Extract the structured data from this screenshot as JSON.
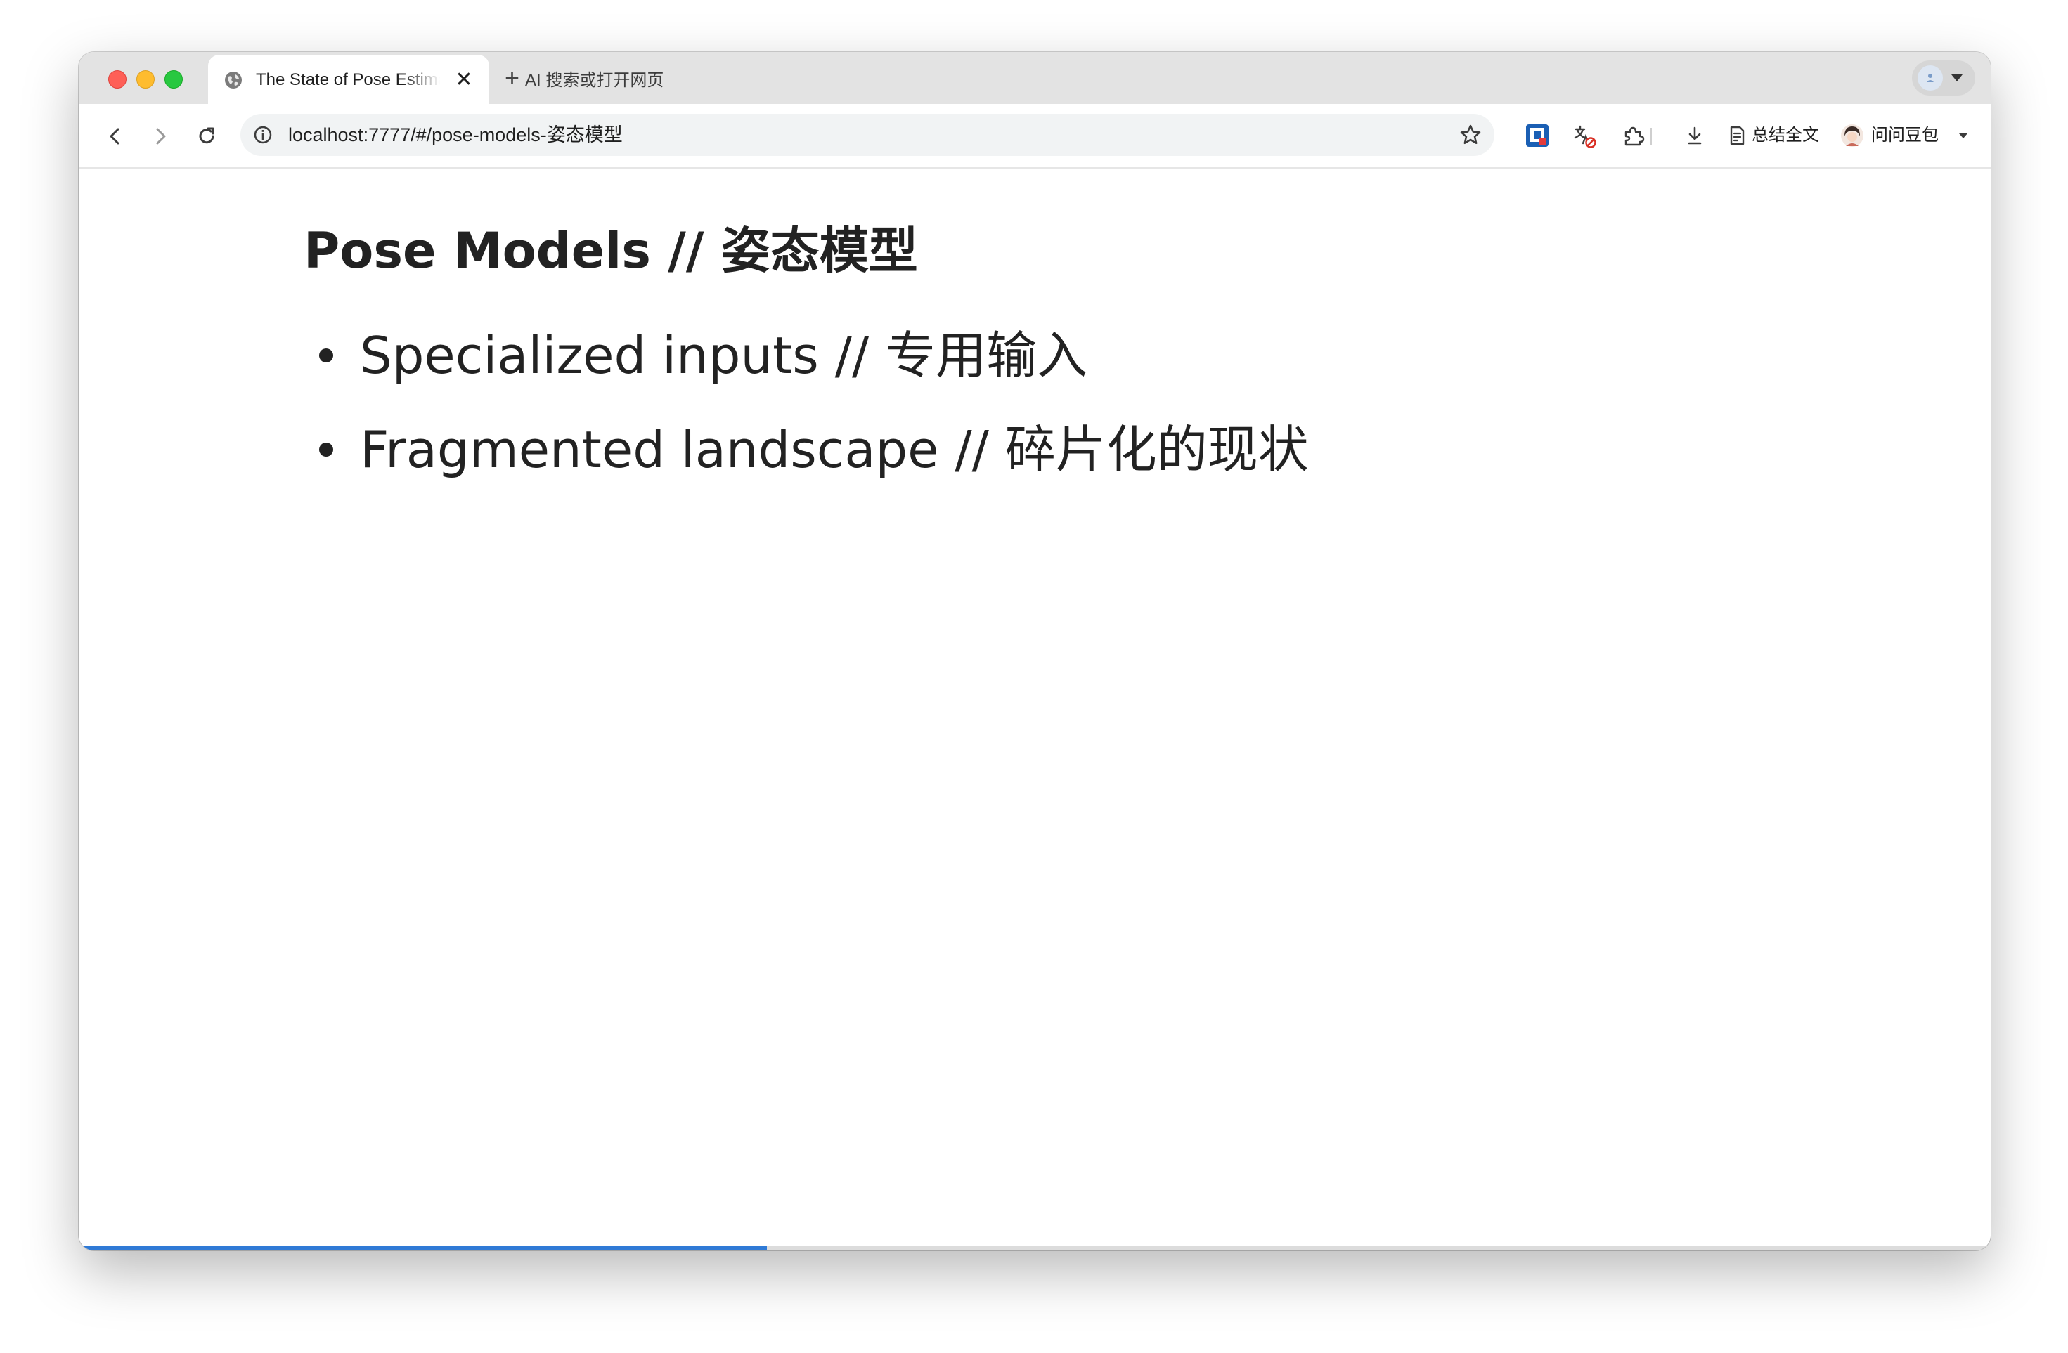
{
  "browser": {
    "tab": {
      "title": "The State of Pose Estimation",
      "close_glyph": "✕"
    },
    "new_tab_label": "AI 搜索或打开网页",
    "address_bar": {
      "url": "localhost:7777/#/pose-models-姿态模型"
    },
    "toolbar": {
      "summary_label": "总结全文",
      "assistant_label": "问问豆包"
    }
  },
  "slide": {
    "title": "Pose Models // 姿态模型",
    "bullets": [
      "Specialized inputs // 专用输入",
      "Fragmented landscape // 碎片化的现状"
    ]
  },
  "presentation": {
    "progress": 0.36,
    "accent_color": "#2f7ad6"
  },
  "icons": {
    "tab_favicon": "globe-icon",
    "back": "back-arrow-icon",
    "forward": "forward-arrow-icon",
    "reload": "reload-icon",
    "site_info": "info-icon",
    "bookmark": "star-icon",
    "extension_1": "bitwarden-icon",
    "translate": "translate-disabled-icon",
    "extensions": "puzzle-icon",
    "downloads": "download-icon",
    "summary": "document-icon",
    "menu": "hamburger-menu-icon"
  }
}
